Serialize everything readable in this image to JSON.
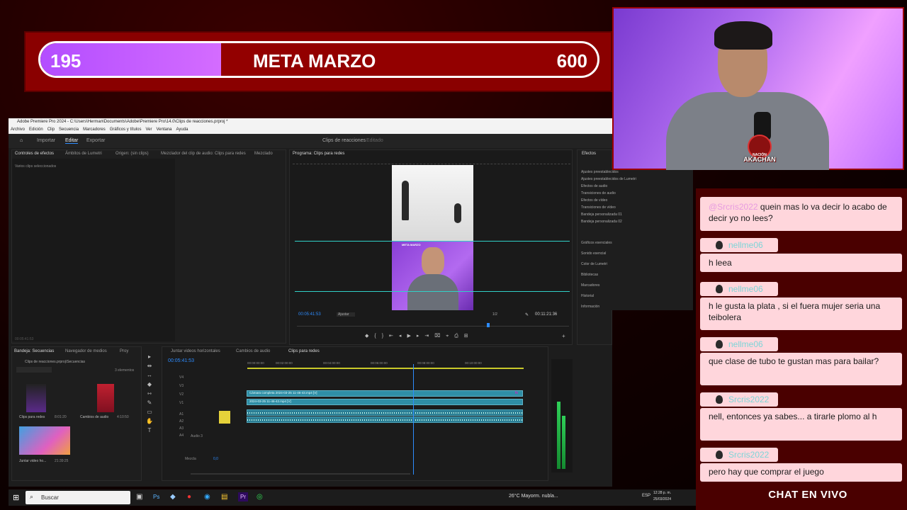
{
  "goal": {
    "current": "195",
    "title": "META MARZO",
    "target": "600",
    "progress": 0.325
  },
  "premiere": {
    "window_title": "Adobe Premiere Pro 2024 - C:\\Users\\Herman\\Documents\\Adobe\\Premiere Pro\\14.0\\Clips de reacciones.prproj *",
    "menu": [
      "Archivo",
      "Edición",
      "Clip",
      "Secuencia",
      "Marcadores",
      "Gráficos y títulos",
      "Ver",
      "Ventana",
      "Ayuda"
    ],
    "workspaces": [
      "Inicio",
      "Importar",
      "Editar",
      "Exportar"
    ],
    "project_title": "Clips de reacciones",
    "project_status": "Editado",
    "source_tabs": [
      "Controles de efectos",
      "Ámbitos de Lumetri",
      "Origen: (sin clips)",
      "Mezclador del clip de audio: Clips para redes",
      "Mezclado"
    ],
    "no_clips_selected": "Varios clips seleccionados",
    "program_tab": "Programa: Clips para redes",
    "overlay_goal_text": "META MARZO",
    "video_caption": "…",
    "timecode": "00:05:41:53",
    "fit": "Ajustar",
    "zoom_ratio": "1/2",
    "duration": "00:11:21:36",
    "effects_title": "Efectos",
    "effects_items": [
      "Ajustes preestablecidos",
      "Ajustes preestablecidos de Lumetri",
      "Efectos de audio",
      "Transiciones de audio",
      "Efectos de vídeo",
      "Transiciones de vídeo",
      "Bandeja personalizada 01",
      "Bandeja personalizada 02"
    ],
    "effects_panels": [
      "Gráficos esenciales",
      "Sonido esencial",
      "Color de Lumetri",
      "Bibliotecas",
      "Marcadores",
      "Historial",
      "Información"
    ],
    "project_tabs": [
      "Bandeja: Secuencias",
      "Navegador de medios",
      "Proy"
    ],
    "project_path": "Clips de reacciones.prproj\\Secuencias",
    "items_count": "3 elementos",
    "bins": [
      {
        "name": "Clips para redes",
        "duration": "8:01:20"
      },
      {
        "name": "Cambios de audio",
        "duration": "4:10:50"
      },
      {
        "name": "Juntar video ho...",
        "duration": "21:39:25"
      }
    ],
    "timeline_tabs": [
      "Juntar videos horizontales",
      "Cambios de audio",
      "Clips para redes"
    ],
    "timeline_timecode": "00:05:41:53",
    "ruler": [
      "00:00:00:00",
      "00:02:00:00",
      "00:04:00:00",
      "00:06:00:00",
      "00:08:00:00",
      "00:10:00:00"
    ],
    "video_tracks": [
      "V4",
      "V3",
      "V2",
      "V1"
    ],
    "audio_tracks": [
      "A1",
      "A2",
      "A3",
      "A4"
    ],
    "audio_track_name": "Audio 3",
    "mix_label": "Mezcla",
    "mix_value": "0,0",
    "clip_v2": "Cámara completa 2024-03-25 11-46-43.mp4 [V]",
    "clip_v1": "2024-03-25 11-46-42.mp4 [V]",
    "fx_badge": "fx",
    "status_timecode": "00:05:41:53"
  },
  "chat": {
    "messages": [
      {
        "user": "@Srcris2022",
        "text": "quein mas lo va decir lo acabo de decir yo no lees?"
      },
      {
        "user": "nellme06",
        "text": "h leea"
      },
      {
        "user": "nellme06",
        "text": "h le gusta la plata , si el fuera mujer seria una teibolera"
      },
      {
        "user": "nellme06",
        "text": "que clase de tubo te gustan mas para bailar?"
      },
      {
        "user": "Srcris2022",
        "text": "nell, entonces ya sabes... a tirarle plomo al h"
      },
      {
        "user": "Srcris2022",
        "text": "pero hay que comprar el juego"
      }
    ],
    "label": "CHAT EN VIVO"
  },
  "badge": {
    "top": "NACIÓN",
    "name": "AKACHAN"
  },
  "taskbar": {
    "search_placeholder": "Buscar",
    "weather": "26°C  Mayorm. nubla...",
    "language": "ESP",
    "time": "12:28 p. m.",
    "date": "25/03/2024"
  },
  "colors": {
    "goal_fill": "#c060ff",
    "chat_bubble": "#ffd6dc",
    "username": "#7dd5d8",
    "premiere_accent": "#2d8cff"
  }
}
